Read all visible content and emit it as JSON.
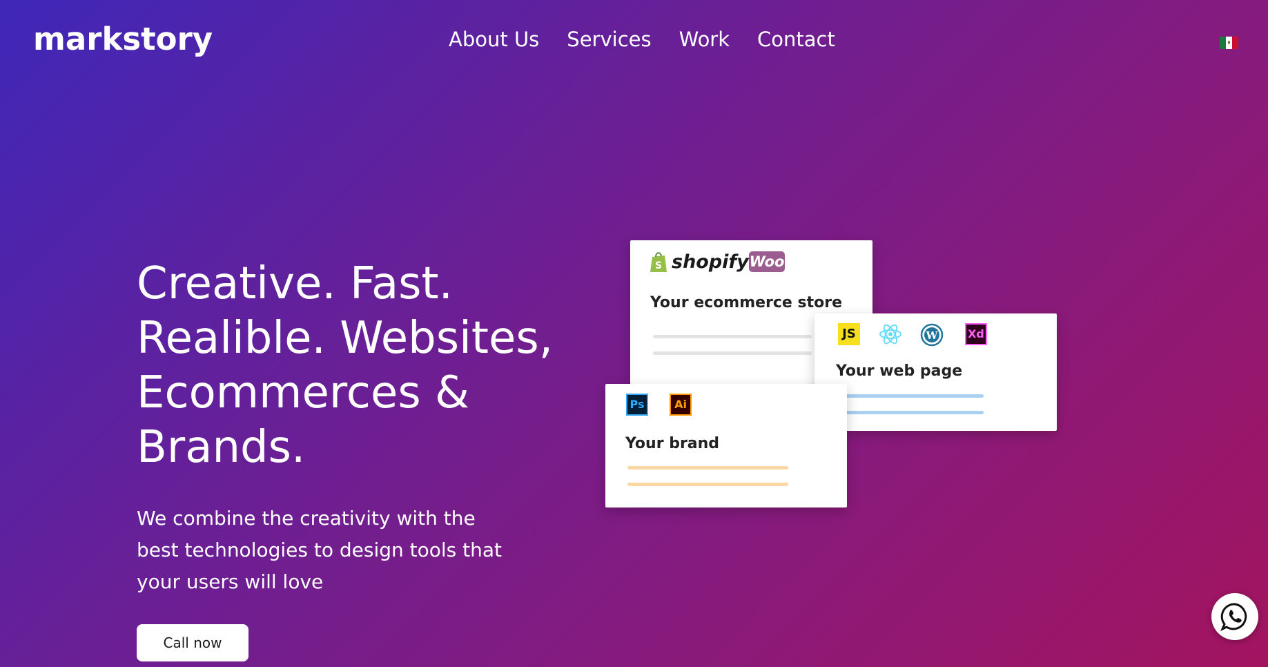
{
  "brand": {
    "logo": "markstory"
  },
  "nav": {
    "items": [
      "About Us",
      "Services",
      "Work",
      "Contact"
    ]
  },
  "language": {
    "icon": "mexico-flag-icon"
  },
  "hero": {
    "title_lines": [
      "Creative. Fast.",
      "Realible. Websites,",
      "Ecommerces &",
      "Brands."
    ],
    "subtitle": "We combine the creativity with the best technologies to design tools that your users will love",
    "cta_label": "Call now"
  },
  "cards": {
    "ecommerce": {
      "shopify_label": "shopify",
      "woo_label": "Woo",
      "title": "Your ecommerce store",
      "line_color": "#e3e3e3"
    },
    "web": {
      "js_label": "JS",
      "xd_label": "Xd",
      "title": "Your web page",
      "line_color": "#a9cff1"
    },
    "brand": {
      "ps_label": "Ps",
      "ai_label": "Ai",
      "title": "Your brand",
      "line_color": "#fbd8a4"
    }
  },
  "colors": {
    "gradient_start": "#3f27b8",
    "gradient_end": "#a3145f",
    "react": "#61dafb",
    "wordpress": "#21759b",
    "shopify": "#95bf47",
    "woo": "#9b5c8f"
  },
  "floating": {
    "whatsapp_icon": "whatsapp-icon"
  }
}
